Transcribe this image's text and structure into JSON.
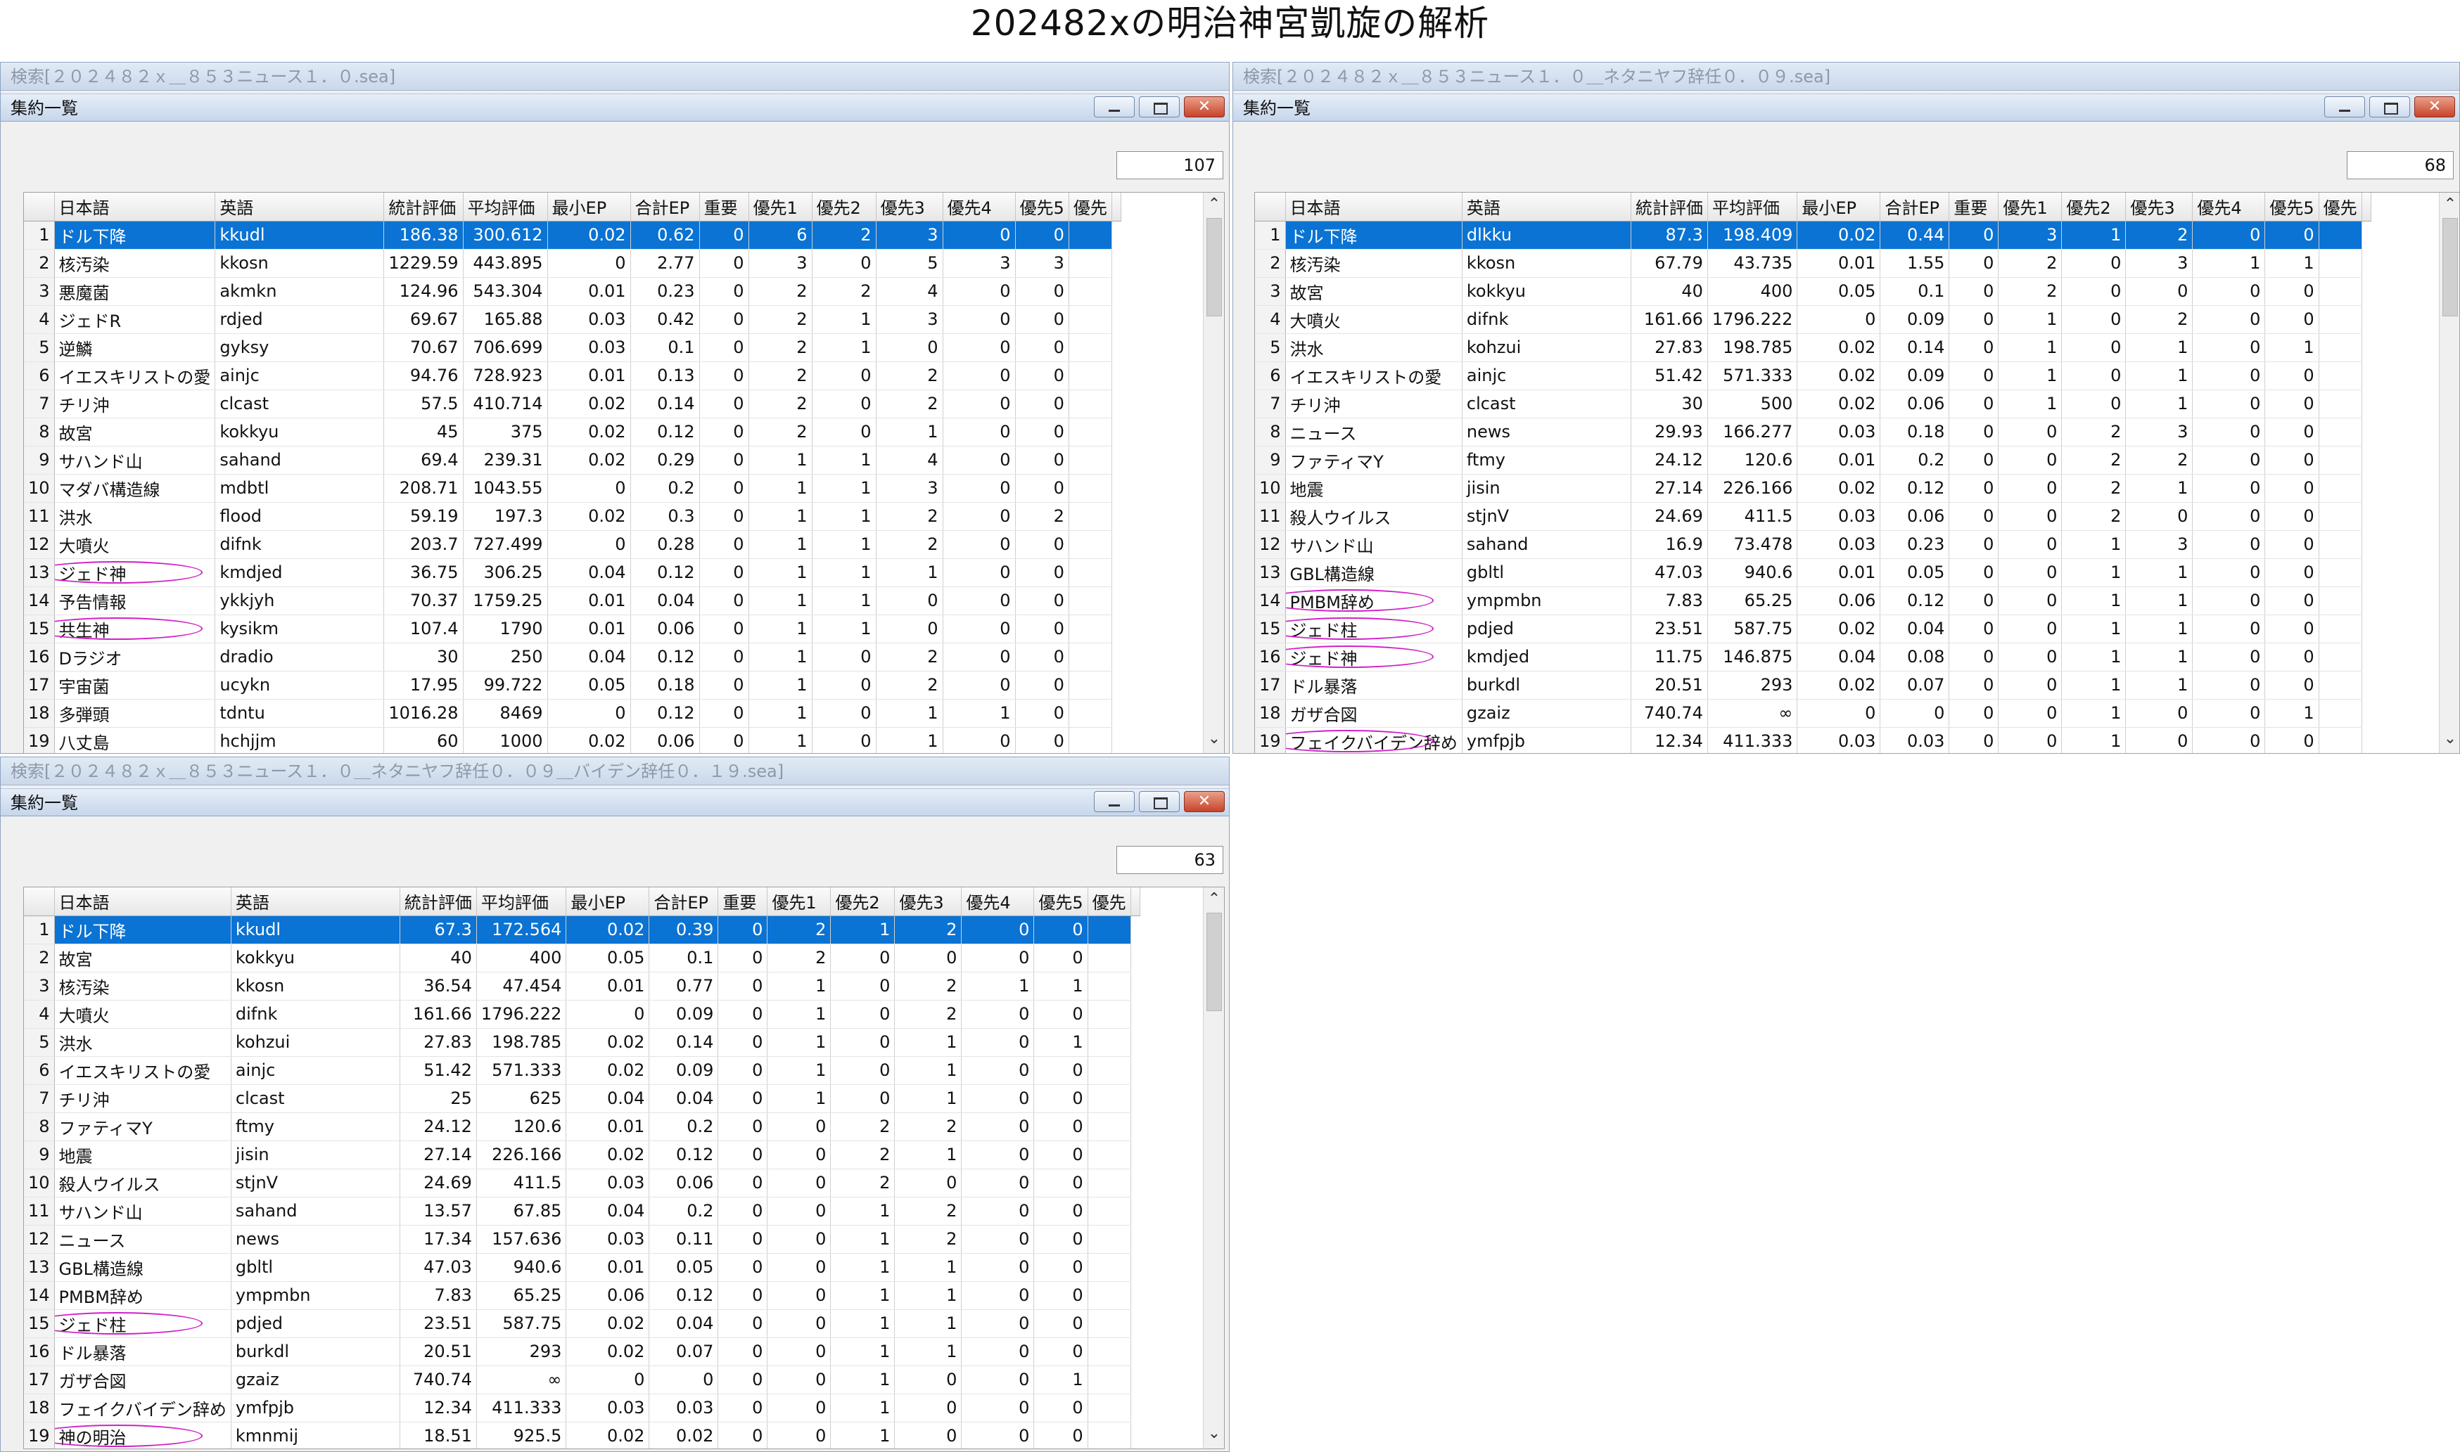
{
  "page_title": "202482xの明治神宮凱旋の解析",
  "columns": [
    "日本語",
    "英語",
    "統計評価",
    "平均評価",
    "最小EP",
    "合計EP",
    "重要",
    "優先1",
    "優先2",
    "優先3",
    "優先4",
    "優先5",
    "優先"
  ],
  "window_buttons": {
    "close": "✕"
  },
  "scroll_arrows": {
    "up": "⌃",
    "down": "⌄"
  },
  "windows": [
    {
      "outer_title": "検索[２０２４８２ｘ＿８５３ニュース１．０.sea]",
      "inner_title": "集約一覧",
      "count": "107",
      "rows": [
        [
          "1",
          "ドル下降",
          "kkudl",
          "186.38",
          "300.612",
          "0.02",
          "0.62",
          "0",
          "6",
          "2",
          "3",
          "0",
          "0"
        ],
        [
          "2",
          "核汚染",
          "kkosn",
          "1229.59",
          "443.895",
          "0",
          "2.77",
          "0",
          "3",
          "0",
          "5",
          "3",
          "3"
        ],
        [
          "3",
          "悪魔菌",
          "akmkn",
          "124.96",
          "543.304",
          "0.01",
          "0.23",
          "0",
          "2",
          "2",
          "4",
          "0",
          "0"
        ],
        [
          "4",
          "ジェドR",
          "rdjed",
          "69.67",
          "165.88",
          "0.03",
          "0.42",
          "0",
          "2",
          "1",
          "3",
          "0",
          "0"
        ],
        [
          "5",
          "逆鱗",
          "gyksy",
          "70.67",
          "706.699",
          "0.03",
          "0.1",
          "0",
          "2",
          "1",
          "0",
          "0",
          "0"
        ],
        [
          "6",
          "イエスキリストの愛",
          "ainjc",
          "94.76",
          "728.923",
          "0.01",
          "0.13",
          "0",
          "2",
          "0",
          "2",
          "0",
          "0"
        ],
        [
          "7",
          "チリ沖",
          "clcast",
          "57.5",
          "410.714",
          "0.02",
          "0.14",
          "0",
          "2",
          "0",
          "2",
          "0",
          "0"
        ],
        [
          "8",
          "故宮",
          "kokkyu",
          "45",
          "375",
          "0.02",
          "0.12",
          "0",
          "2",
          "0",
          "1",
          "0",
          "0"
        ],
        [
          "9",
          "サハンド山",
          "sahand",
          "69.4",
          "239.31",
          "0.02",
          "0.29",
          "0",
          "1",
          "1",
          "4",
          "0",
          "0"
        ],
        [
          "10",
          "マダバ構造線",
          "mdbtl",
          "208.71",
          "1043.55",
          "0",
          "0.2",
          "0",
          "1",
          "1",
          "3",
          "0",
          "0"
        ],
        [
          "11",
          "洪水",
          "flood",
          "59.19",
          "197.3",
          "0.02",
          "0.3",
          "0",
          "1",
          "1",
          "2",
          "0",
          "2"
        ],
        [
          "12",
          "大噴火",
          "difnk",
          "203.7",
          "727.499",
          "0",
          "0.28",
          "0",
          "1",
          "1",
          "2",
          "0",
          "0"
        ],
        [
          "13",
          "ジェド神",
          "kmdjed",
          "36.75",
          "306.25",
          "0.04",
          "0.12",
          "0",
          "1",
          "1",
          "1",
          "0",
          "0"
        ],
        [
          "14",
          "予告情報",
          "ykkjyh",
          "70.37",
          "1759.25",
          "0.01",
          "0.04",
          "0",
          "1",
          "1",
          "0",
          "0",
          "0"
        ],
        [
          "15",
          "共生神",
          "kysikm",
          "107.4",
          "1790",
          "0.01",
          "0.06",
          "0",
          "1",
          "1",
          "0",
          "0",
          "0"
        ],
        [
          "16",
          "Dラジオ",
          "dradio",
          "30",
          "250",
          "0.04",
          "0.12",
          "0",
          "1",
          "0",
          "2",
          "0",
          "0"
        ],
        [
          "17",
          "宇宙菌",
          "ucykn",
          "17.95",
          "99.722",
          "0.05",
          "0.18",
          "0",
          "1",
          "0",
          "2",
          "0",
          "0"
        ],
        [
          "18",
          "多弾頭",
          "tdntu",
          "1016.28",
          "8469",
          "0",
          "0.12",
          "0",
          "1",
          "0",
          "1",
          "1",
          "0"
        ],
        [
          "19",
          "八丈島",
          "hchjjm",
          "60",
          "1000",
          "0.02",
          "0.06",
          "0",
          "1",
          "0",
          "1",
          "0",
          "0"
        ]
      ]
    },
    {
      "outer_title": "検索[２０２４８２ｘ＿８５３ニュース１．０＿ネタニヤフ辞任０．０９.sea]",
      "inner_title": "集約一覧",
      "count": "68",
      "rows": [
        [
          "1",
          "ドル下降",
          "dlkku",
          "87.3",
          "198.409",
          "0.02",
          "0.44",
          "0",
          "3",
          "1",
          "2",
          "0",
          "0"
        ],
        [
          "2",
          "核汚染",
          "kkosn",
          "67.79",
          "43.735",
          "0.01",
          "1.55",
          "0",
          "2",
          "0",
          "3",
          "1",
          "1"
        ],
        [
          "3",
          "故宮",
          "kokkyu",
          "40",
          "400",
          "0.05",
          "0.1",
          "0",
          "2",
          "0",
          "0",
          "0",
          "0"
        ],
        [
          "4",
          "大噴火",
          "difnk",
          "161.66",
          "1796.222",
          "0",
          "0.09",
          "0",
          "1",
          "0",
          "2",
          "0",
          "0"
        ],
        [
          "5",
          "洪水",
          "kohzui",
          "27.83",
          "198.785",
          "0.02",
          "0.14",
          "0",
          "1",
          "0",
          "1",
          "0",
          "1"
        ],
        [
          "6",
          "イエスキリストの愛",
          "ainjc",
          "51.42",
          "571.333",
          "0.02",
          "0.09",
          "0",
          "1",
          "0",
          "1",
          "0",
          "0"
        ],
        [
          "7",
          "チリ沖",
          "clcast",
          "30",
          "500",
          "0.02",
          "0.06",
          "0",
          "1",
          "0",
          "1",
          "0",
          "0"
        ],
        [
          "8",
          "ニュース",
          "news",
          "29.93",
          "166.277",
          "0.03",
          "0.18",
          "0",
          "0",
          "2",
          "3",
          "0",
          "0"
        ],
        [
          "9",
          "ファティマY",
          "ftmy",
          "24.12",
          "120.6",
          "0.01",
          "0.2",
          "0",
          "0",
          "2",
          "2",
          "0",
          "0"
        ],
        [
          "10",
          "地震",
          "jisin",
          "27.14",
          "226.166",
          "0.02",
          "0.12",
          "0",
          "0",
          "2",
          "1",
          "0",
          "0"
        ],
        [
          "11",
          "殺人ウイルス",
          "stjnV",
          "24.69",
          "411.5",
          "0.03",
          "0.06",
          "0",
          "0",
          "2",
          "0",
          "0",
          "0"
        ],
        [
          "12",
          "サハンド山",
          "sahand",
          "16.9",
          "73.478",
          "0.03",
          "0.23",
          "0",
          "0",
          "1",
          "3",
          "0",
          "0"
        ],
        [
          "13",
          "GBL構造線",
          "gbltl",
          "47.03",
          "940.6",
          "0.01",
          "0.05",
          "0",
          "0",
          "1",
          "1",
          "0",
          "0"
        ],
        [
          "14",
          "PMBM辞め",
          "ympmbn",
          "7.83",
          "65.25",
          "0.06",
          "0.12",
          "0",
          "0",
          "1",
          "1",
          "0",
          "0"
        ],
        [
          "15",
          "ジェド柱",
          "pdjed",
          "23.51",
          "587.75",
          "0.02",
          "0.04",
          "0",
          "0",
          "1",
          "1",
          "0",
          "0"
        ],
        [
          "16",
          "ジェド神",
          "kmdjed",
          "11.75",
          "146.875",
          "0.04",
          "0.08",
          "0",
          "0",
          "1",
          "1",
          "0",
          "0"
        ],
        [
          "17",
          "ドル暴落",
          "burkdl",
          "20.51",
          "293",
          "0.02",
          "0.07",
          "0",
          "0",
          "1",
          "1",
          "0",
          "0"
        ],
        [
          "18",
          "ガザ合図",
          "gzaiz",
          "740.74",
          "∞",
          "0",
          "0",
          "0",
          "0",
          "1",
          "0",
          "0",
          "1"
        ],
        [
          "19",
          "フェイクバイデン辞め",
          "ymfpjb",
          "12.34",
          "411.333",
          "0.03",
          "0.03",
          "0",
          "0",
          "1",
          "0",
          "0",
          "0"
        ]
      ]
    },
    {
      "outer_title": "検索[２０２４８２ｘ＿８５３ニュース１．０＿ネタニヤフ辞任０．０９＿バイデン辞任０．１９.sea]",
      "inner_title": "集約一覧",
      "count": "63",
      "rows": [
        [
          "1",
          "ドル下降",
          "kkudl",
          "67.3",
          "172.564",
          "0.02",
          "0.39",
          "0",
          "2",
          "1",
          "2",
          "0",
          "0"
        ],
        [
          "2",
          "故宮",
          "kokkyu",
          "40",
          "400",
          "0.05",
          "0.1",
          "0",
          "2",
          "0",
          "0",
          "0",
          "0"
        ],
        [
          "3",
          "核汚染",
          "kkosn",
          "36.54",
          "47.454",
          "0.01",
          "0.77",
          "0",
          "1",
          "0",
          "2",
          "1",
          "1"
        ],
        [
          "4",
          "大噴火",
          "difnk",
          "161.66",
          "1796.222",
          "0",
          "0.09",
          "0",
          "1",
          "0",
          "2",
          "0",
          "0"
        ],
        [
          "5",
          "洪水",
          "kohzui",
          "27.83",
          "198.785",
          "0.02",
          "0.14",
          "0",
          "1",
          "0",
          "1",
          "0",
          "1"
        ],
        [
          "6",
          "イエスキリストの愛",
          "ainjc",
          "51.42",
          "571.333",
          "0.02",
          "0.09",
          "0",
          "1",
          "0",
          "1",
          "0",
          "0"
        ],
        [
          "7",
          "チリ沖",
          "clcast",
          "25",
          "625",
          "0.04",
          "0.04",
          "0",
          "1",
          "0",
          "1",
          "0",
          "0"
        ],
        [
          "8",
          "ファティマY",
          "ftmy",
          "24.12",
          "120.6",
          "0.01",
          "0.2",
          "0",
          "0",
          "2",
          "2",
          "0",
          "0"
        ],
        [
          "9",
          "地震",
          "jisin",
          "27.14",
          "226.166",
          "0.02",
          "0.12",
          "0",
          "0",
          "2",
          "1",
          "0",
          "0"
        ],
        [
          "10",
          "殺人ウイルス",
          "stjnV",
          "24.69",
          "411.5",
          "0.03",
          "0.06",
          "0",
          "0",
          "2",
          "0",
          "0",
          "0"
        ],
        [
          "11",
          "サハンド山",
          "sahand",
          "13.57",
          "67.85",
          "0.04",
          "0.2",
          "0",
          "0",
          "1",
          "2",
          "0",
          "0"
        ],
        [
          "12",
          "ニュース",
          "news",
          "17.34",
          "157.636",
          "0.03",
          "0.11",
          "0",
          "0",
          "1",
          "2",
          "0",
          "0"
        ],
        [
          "13",
          "GBL構造線",
          "gbltl",
          "47.03",
          "940.6",
          "0.01",
          "0.05",
          "0",
          "0",
          "1",
          "1",
          "0",
          "0"
        ],
        [
          "14",
          "PMBM辞め",
          "ympmbn",
          "7.83",
          "65.25",
          "0.06",
          "0.12",
          "0",
          "0",
          "1",
          "1",
          "0",
          "0"
        ],
        [
          "15",
          "ジェド柱",
          "pdjed",
          "23.51",
          "587.75",
          "0.02",
          "0.04",
          "0",
          "0",
          "1",
          "1",
          "0",
          "0"
        ],
        [
          "16",
          "ドル暴落",
          "burkdl",
          "20.51",
          "293",
          "0.02",
          "0.07",
          "0",
          "0",
          "1",
          "1",
          "0",
          "0"
        ],
        [
          "17",
          "ガザ合図",
          "gzaiz",
          "740.74",
          "∞",
          "0",
          "0",
          "0",
          "0",
          "1",
          "0",
          "0",
          "1"
        ],
        [
          "18",
          "フェイクバイデン辞め",
          "ymfpjb",
          "12.34",
          "411.333",
          "0.03",
          "0.03",
          "0",
          "0",
          "1",
          "0",
          "0",
          "0"
        ],
        [
          "19",
          "神の明治",
          "kmnmij",
          "18.51",
          "925.5",
          "0.02",
          "0.02",
          "0",
          "0",
          "1",
          "0",
          "0",
          "0"
        ]
      ]
    }
  ]
}
